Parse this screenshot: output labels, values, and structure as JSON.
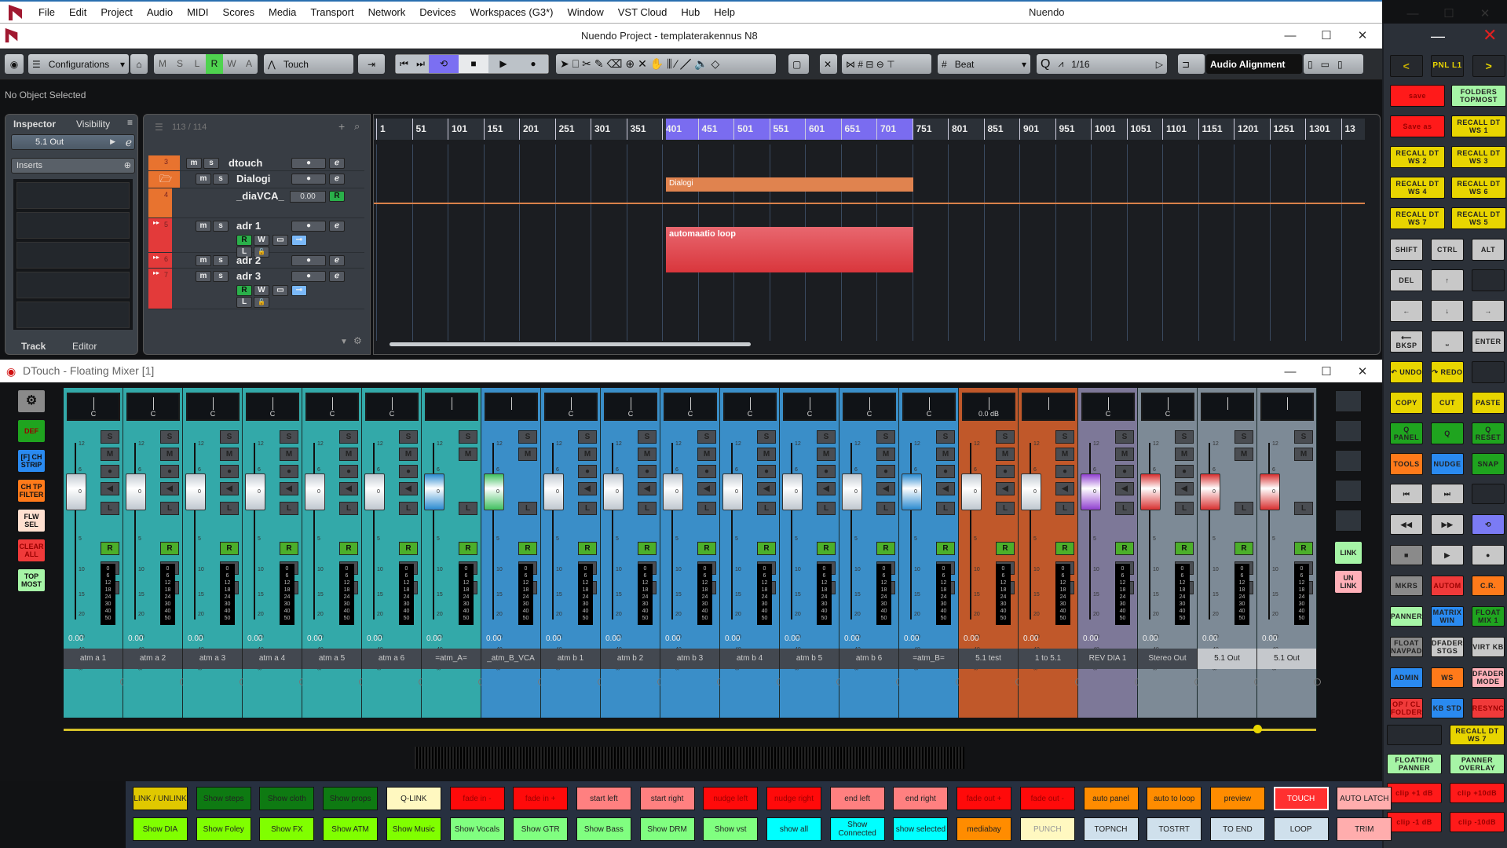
{
  "menubar": {
    "items": [
      "File",
      "Edit",
      "Project",
      "Audio",
      "MIDI",
      "Scores",
      "Media",
      "Transport",
      "Network",
      "Devices",
      "Workspaces (G3*)",
      "Window",
      "VST Cloud",
      "Hub",
      "Help"
    ],
    "app_title": "Nuendo",
    "minimize": "—",
    "maximize": "☐",
    "close": "✕"
  },
  "project": {
    "title": "Nuendo Project - templaterakennus N8"
  },
  "toolbar": {
    "configurations": "Configurations",
    "msl": [
      "M",
      "S",
      "L",
      "R",
      "W",
      "A"
    ],
    "automation_mode": "Touch",
    "grid_type": "Beat",
    "quantize": "1/16",
    "audio_alignment": "Audio Alignment",
    "active_color": "#4fd34f",
    "cycle_color": "#7b6ff2"
  },
  "info_line": "No Object Selected",
  "inspector": {
    "tabs": [
      "Inspector",
      "Visibility"
    ],
    "output": "5.1 Out",
    "inserts": "Inserts",
    "bottom_tabs": [
      "Track",
      "Editor"
    ]
  },
  "tracklist": {
    "count": "113 / 114",
    "tracks": [
      {
        "num": "3",
        "name": "dtouch",
        "color": "#e8732f"
      },
      {
        "num": "",
        "name": "Dialogi",
        "color": "#e8732f"
      },
      {
        "num": "4",
        "name": "_diaVCA_",
        "value": "0.00",
        "color": "#e8732f"
      },
      {
        "num": "5",
        "name": "adr 1",
        "color": "#e33a3a"
      },
      {
        "num": "6",
        "name": "adr 2",
        "color": "#e33a3a"
      },
      {
        "num": "7",
        "name": "adr 3",
        "color": "#e33a3a"
      }
    ],
    "buttons": {
      "mute": "m",
      "solo": "s",
      "read": "R",
      "write": "W",
      "lane": "L"
    }
  },
  "timeline": {
    "ticks": [
      "1",
      "51",
      "101",
      "151",
      "201",
      "251",
      "301",
      "351",
      "401",
      "451",
      "501",
      "551",
      "601",
      "651",
      "701",
      "751",
      "801",
      "851",
      "901",
      "951",
      "1001",
      "1051",
      "1101",
      "1151",
      "1201",
      "1251",
      "1301",
      "13"
    ],
    "loop_range": {
      "start": "401",
      "end": "701"
    },
    "events": [
      {
        "name": "Dialogi",
        "color": "#e0834f"
      },
      {
        "name": "automaatio loop",
        "color": "#d9363c"
      }
    ]
  },
  "right_panel": {
    "page": "PNL L1",
    "prev": "<",
    "next": ">",
    "grid1": [
      {
        "label": "save",
        "color": "#ff1a1a"
      },
      {
        "label": "FOLDERS TOPMOST",
        "color": "#a6f5a6"
      },
      {
        "label": "Save as",
        "color": "#ff1a1a"
      },
      {
        "label": "RECALL DT WS 1",
        "color": "#e8d500"
      },
      {
        "label": "RECALL DT WS 2",
        "color": "#e8d500"
      },
      {
        "label": "RECALL DT WS 3",
        "color": "#e8d500"
      },
      {
        "label": "RECALL DT WS 4",
        "color": "#e8d500"
      },
      {
        "label": "RECALL DT WS 6",
        "color": "#e8d500"
      },
      {
        "label": "RECALL DT WS 7",
        "color": "#e8d500"
      },
      {
        "label": "RECALL DT WS 5",
        "color": "#e8d500"
      }
    ],
    "keys": [
      {
        "label": "SHIFT",
        "color": "#c8c8c8"
      },
      {
        "label": "CTRL",
        "color": "#c8c8c8"
      },
      {
        "label": "ALT",
        "color": "#c8c8c8"
      },
      {
        "label": "DEL",
        "color": "#c8c8c8"
      },
      {
        "label": "↑",
        "color": "#c8c8c8"
      },
      {
        "label": "",
        "color": "#2b3038"
      },
      {
        "label": "←",
        "color": "#c8c8c8"
      },
      {
        "label": "↓",
        "color": "#c8c8c8"
      },
      {
        "label": "→",
        "color": "#c8c8c8"
      },
      {
        "label": "⟵ BKSP",
        "color": "#c8c8c8"
      },
      {
        "label": "⎵",
        "color": "#c8c8c8"
      },
      {
        "label": "ENTER",
        "color": "#c8c8c8"
      }
    ],
    "edit": [
      {
        "label": "↶ UNDO",
        "color": "#e8d500"
      },
      {
        "label": "↷ REDO",
        "color": "#e8d500"
      },
      {
        "label": "",
        "color": "#2b3038"
      },
      {
        "label": "COPY",
        "color": "#e8d500"
      },
      {
        "label": "CUT",
        "color": "#e8d500"
      },
      {
        "label": "PASTE",
        "color": "#e8d500"
      },
      {
        "label": "Q PANEL",
        "color": "#1fa41f"
      },
      {
        "label": "Q",
        "color": "#1fa41f"
      },
      {
        "label": "Q RESET",
        "color": "#1fa41f"
      },
      {
        "label": "TOOLS",
        "color": "#ff7a1a"
      },
      {
        "label": "NUDGE",
        "color": "#2a8af0"
      },
      {
        "label": "SNAP",
        "color": "#1fa41f"
      }
    ],
    "transport": [
      {
        "label": "⏮",
        "color": "#c8c8c8"
      },
      {
        "label": "⏭",
        "color": "#c8c8c8"
      },
      {
        "label": "",
        "color": "#2b3038"
      },
      {
        "label": "◀◀",
        "color": "#c8c8c8"
      },
      {
        "label": "▶▶",
        "color": "#c8c8c8"
      },
      {
        "label": "⟲",
        "color": "#7b7bf5"
      },
      {
        "label": "■",
        "color": "#8a8a8a"
      },
      {
        "label": "▶",
        "color": "#c8c8c8"
      },
      {
        "label": "●",
        "color": "#c8c8c8"
      }
    ],
    "windows": [
      {
        "label": "MKRS",
        "color": "#8a8a8a"
      },
      {
        "label": "AUTOM",
        "color": "#f03a3a"
      },
      {
        "label": "C.R.",
        "color": "#ff7a1a"
      },
      {
        "label": "PANNER",
        "color": "#a6f5a6"
      },
      {
        "label": "MATRIX WIN",
        "color": "#2a8af0"
      },
      {
        "label": "FLOAT MIX 1",
        "color": "#1fa41f"
      },
      {
        "label": "FLOAT NAVPAD",
        "color": "#8a8a8a"
      },
      {
        "label": "DFADER STGS",
        "color": "#c8c8c8"
      },
      {
        "label": "VIRT KB",
        "color": "#c8c8c8"
      },
      {
        "label": "ADMIN",
        "color": "#2a8af0"
      },
      {
        "label": "WS",
        "color": "#ff7a1a"
      },
      {
        "label": "DFADER MODE",
        "color": "#ffb0b8"
      },
      {
        "label": "OP / CL FOLDER",
        "color": "#f03a3a"
      },
      {
        "label": "KB STD",
        "color": "#2a8af0"
      },
      {
        "label": "RESYNC",
        "color": "#f03a3a"
      }
    ],
    "bottom": [
      {
        "label": "",
        "color": "#2b3038"
      },
      {
        "label": "RECALL DT WS 7",
        "color": "#e8d500"
      },
      {
        "label": "FLOATING PANNER",
        "color": "#a6f5a6"
      },
      {
        "label": "PANNER OVERLAY",
        "color": "#a6f5a6"
      },
      {
        "label": "clip +1 dB",
        "color": "#ff1a1a"
      },
      {
        "label": "clip +10dB",
        "color": "#ff1a1a"
      },
      {
        "label": "clip -1 dB",
        "color": "#ff1a1a"
      },
      {
        "label": "clip -10dB",
        "color": "#ff1a1a"
      }
    ]
  },
  "mixer": {
    "title": "DTouch - Floating Mixer [1]",
    "left_buttons": [
      {
        "label": "⚙",
        "color": "#8a8a8a"
      },
      {
        "label": "DEF",
        "color": "#1fa41f"
      },
      {
        "label": "[F] CH STRIP",
        "color": "#2a8af0"
      },
      {
        "label": "CH TP FILTER",
        "color": "#ff7a1a"
      },
      {
        "label": "FLW SEL",
        "color": "#ffe0d0"
      },
      {
        "label": "CLEAR ALL",
        "color": "#f03a3a"
      },
      {
        "label": "TOP MOST",
        "color": "#a6f5a6"
      }
    ],
    "right_buttons": [
      {
        "label": "LINK",
        "color": "#a6f5a6"
      },
      {
        "label": "UN LINK",
        "color": "#ffb0b8"
      }
    ],
    "strip_buttons": {
      "solo": "S",
      "mute": "M",
      "rec": "●",
      "monitor": "◀",
      "listen": "L",
      "read": "R",
      "write": "W",
      "edit": "E"
    },
    "fader_scale": [
      "12",
      "6",
      "0",
      "5",
      "10",
      "15",
      "20",
      "30",
      "40",
      "50",
      "∞"
    ],
    "meter_scale": [
      "0",
      "6",
      "12",
      "18",
      "24",
      "30",
      "40",
      "50"
    ],
    "channels": [
      {
        "name": "atm a 1",
        "volume": "0.00",
        "pan": "C",
        "color": "#33a9a9",
        "fader": "#c0c8d0"
      },
      {
        "name": "atm a 2",
        "volume": "0.00",
        "pan": "C",
        "color": "#33a9a9",
        "fader": "#c0c8d0"
      },
      {
        "name": "atm a 3",
        "volume": "0.00",
        "pan": "C",
        "color": "#33a9a9",
        "fader": "#c0c8d0"
      },
      {
        "name": "atm a 4",
        "volume": "0.00",
        "pan": "C",
        "color": "#33a9a9",
        "fader": "#c0c8d0"
      },
      {
        "name": "atm a 5",
        "volume": "0.00",
        "pan": "C",
        "color": "#33a9a9",
        "fader": "#c0c8d0"
      },
      {
        "name": "atm a 6",
        "volume": "0.00",
        "pan": "C",
        "color": "#33a9a9",
        "fader": "#c0c8d0"
      },
      {
        "name": "=atm_A=",
        "volume": "0.00",
        "pan": "",
        "color": "#33a9a9",
        "fader": "#2a8ad0"
      },
      {
        "name": "_atm_B_VCA",
        "volume": "0.00",
        "pan": "",
        "color": "#3a8ec8",
        "fader": "#40c060"
      },
      {
        "name": "atm b 1",
        "volume": "0.00",
        "pan": "C",
        "color": "#3a8ec8",
        "fader": "#c0c8d0"
      },
      {
        "name": "atm b 2",
        "volume": "0.00",
        "pan": "C",
        "color": "#3a8ec8",
        "fader": "#c0c8d0"
      },
      {
        "name": "atm b 3",
        "volume": "0.00",
        "pan": "C",
        "color": "#3a8ec8",
        "fader": "#c0c8d0"
      },
      {
        "name": "atm b 4",
        "volume": "0.00",
        "pan": "C",
        "color": "#3a8ec8",
        "fader": "#c0c8d0"
      },
      {
        "name": "atm b 5",
        "volume": "0.00",
        "pan": "C",
        "color": "#3a8ec8",
        "fader": "#c0c8d0"
      },
      {
        "name": "atm b 6",
        "volume": "0.00",
        "pan": "C",
        "color": "#3a8ec8",
        "fader": "#c0c8d0"
      },
      {
        "name": "=atm_B=",
        "volume": "0.00",
        "pan": "C",
        "color": "#3a8ec8",
        "fader": "#2a8ad0"
      },
      {
        "name": "5.1 test",
        "volume": "0.00",
        "pan": "0.0 dB",
        "color": "#c0582a",
        "fader": "#c0c8d0"
      },
      {
        "name": "1 to 5.1",
        "volume": "0.00",
        "pan": "",
        "color": "#c0582a",
        "fader": "#c0c8d0"
      },
      {
        "name": "REV DIA 1",
        "volume": "0.00",
        "pan": "C",
        "color": "#7d7898",
        "fader": "#9040d0"
      },
      {
        "name": "Stereo Out",
        "volume": "0.00",
        "pan": "C",
        "color": "#7d8a96",
        "fader": "#d83030"
      },
      {
        "name": "5.1 Out",
        "volume": "0.00",
        "pan": "",
        "color": "#7d8a96",
        "fader": "#d83030"
      },
      {
        "name": "5.1 Out",
        "volume": "0.00",
        "pan": "",
        "color": "#7d8a96",
        "fader": "#d83030"
      }
    ]
  },
  "bottom_bar": {
    "row1": [
      {
        "label": "LINK / UNLINK",
        "color": "#e0c800",
        "text": "#222"
      },
      {
        "label": "Show steps",
        "color": "#0e7a12",
        "text": "#222"
      },
      {
        "label": "Show cloth",
        "color": "#0e7a12",
        "text": "#222"
      },
      {
        "label": "Show props",
        "color": "#0e7a12",
        "text": "#222"
      },
      {
        "label": "Q-LINK",
        "color": "#fff8c0",
        "text": "#222"
      },
      {
        "label": "fade in -",
        "color": "#ff0a0a",
        "text": "#900"
      },
      {
        "label": "fade in +",
        "color": "#ff0a0a",
        "text": "#900"
      },
      {
        "label": "start left",
        "color": "#ff8080",
        "text": "#222"
      },
      {
        "label": "start right",
        "color": "#ff8080",
        "text": "#222"
      },
      {
        "label": "nudge left",
        "color": "#ff0a0a",
        "text": "#900"
      },
      {
        "label": "nudge right",
        "color": "#ff0a0a",
        "text": "#900"
      },
      {
        "label": "end left",
        "color": "#ff8080",
        "text": "#222"
      },
      {
        "label": "end right",
        "color": "#ff8080",
        "text": "#222"
      },
      {
        "label": "fade out +",
        "color": "#ff0a0a",
        "text": "#900"
      },
      {
        "label": "fade out -",
        "color": "#ff0a0a",
        "text": "#900"
      },
      {
        "label": "auto panel",
        "color": "#ff8c00",
        "text": "#222"
      },
      {
        "label": "auto to loop",
        "color": "#ff8c00",
        "text": "#222"
      },
      {
        "label": "preview",
        "color": "#ff8c00",
        "text": "#222"
      },
      {
        "label": "TOUCH",
        "color": "#ff3030",
        "text": "#fff"
      },
      {
        "label": "AUTO LATCH",
        "color": "#ffadad",
        "text": "#222"
      }
    ],
    "row2": [
      {
        "label": "Show DIA",
        "color": "#80ff00",
        "text": "#222"
      },
      {
        "label": "Show Foley",
        "color": "#80ff00",
        "text": "#222"
      },
      {
        "label": "Show FX",
        "color": "#80ff00",
        "text": "#222"
      },
      {
        "label": "Show ATM",
        "color": "#80ff00",
        "text": "#222"
      },
      {
        "label": "Show Music",
        "color": "#80ff00",
        "text": "#222"
      },
      {
        "label": "Show Vocals",
        "color": "#80ff80",
        "text": "#222"
      },
      {
        "label": "Show GTR",
        "color": "#80ff80",
        "text": "#222"
      },
      {
        "label": "Show Bass",
        "color": "#80ff80",
        "text": "#222"
      },
      {
        "label": "Show DRM",
        "color": "#80ff80",
        "text": "#222"
      },
      {
        "label": "Show vst",
        "color": "#80ff80",
        "text": "#222"
      },
      {
        "label": "show all",
        "color": "#00ffff",
        "text": "#222"
      },
      {
        "label": "Show Connected",
        "color": "#00ffff",
        "text": "#222"
      },
      {
        "label": "show selected",
        "color": "#00ffff",
        "text": "#222"
      },
      {
        "label": "mediabay",
        "color": "#ff8c00",
        "text": "#222"
      },
      {
        "label": "PUNCH",
        "color": "#fff8c0",
        "text": "#999"
      },
      {
        "label": "TOPNCH",
        "color": "#cfe0ec",
        "text": "#222"
      },
      {
        "label": "TOSTRT",
        "color": "#cfe0ec",
        "text": "#222"
      },
      {
        "label": "TO END",
        "color": "#cfe0ec",
        "text": "#222"
      },
      {
        "label": "LOOP",
        "color": "#cfe0ec",
        "text": "#222"
      },
      {
        "label": "TRIM",
        "color": "#ffadad",
        "text": "#222"
      }
    ]
  }
}
